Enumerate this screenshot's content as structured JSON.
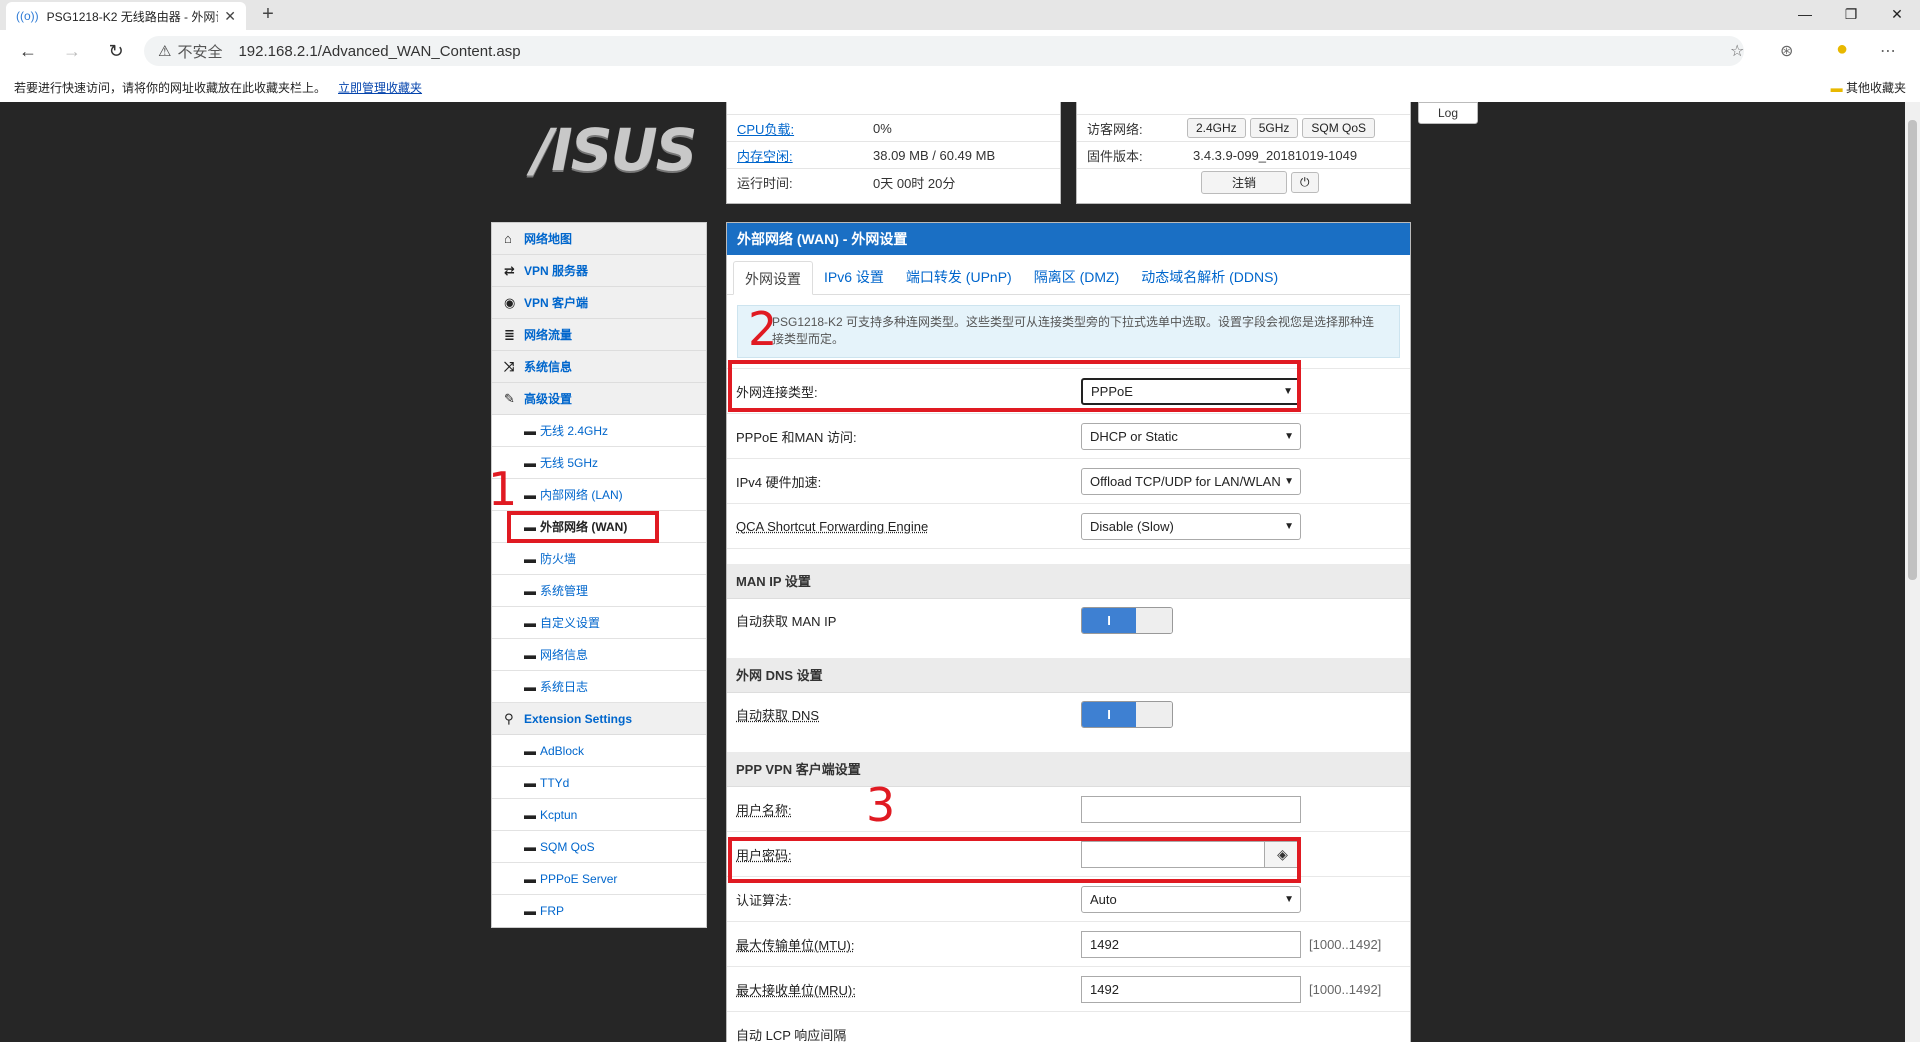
{
  "browser": {
    "tab_title": "PSG1218-K2 无线路由器 - 外网设",
    "tab_icon": "((o))",
    "new_tab": "+",
    "insecure_label": "不安全",
    "url": "192.168.2.1/Advanced_WAN_Content.asp",
    "bookmark_hint": "若要进行快速访问，请将你的网址收藏放在此收藏夹栏上。",
    "bookmark_link": "立即管理收藏夹",
    "other_bookmarks": "其他收藏夹"
  },
  "status": {
    "cpu_label": "CPU负载:",
    "cpu_value": "0%",
    "mem_label": "内存空闲:",
    "mem_value": "38.09 MB / 60.49 MB",
    "uptime_label": "运行时间:",
    "uptime_value": "0天 00时 20分",
    "guest_label": "访客网络:",
    "guest_buttons": [
      "2.4GHz",
      "5GHz",
      "SQM QoS"
    ],
    "fw_label": "固件版本:",
    "fw_value": "3.4.3.9-099_20181019-1049",
    "logout": "注销",
    "log": "Log"
  },
  "logo": "/ISUS",
  "sidebar": {
    "menus": [
      {
        "icon": "⌂",
        "label": "网络地图"
      },
      {
        "icon": "⇄",
        "label": "VPN 服务器"
      },
      {
        "icon": "◉",
        "label": "VPN 客户端"
      },
      {
        "icon": "≣",
        "label": "网络流量"
      },
      {
        "icon": "⤨",
        "label": "系统信息"
      },
      {
        "icon": "✎",
        "label": "高级设置"
      }
    ],
    "advanced": [
      "无线 2.4GHz",
      "无线 5GHz",
      "内部网络 (LAN)",
      "外部网络 (WAN)",
      "防火墙",
      "系统管理",
      "自定义设置",
      "网络信息",
      "系统日志"
    ],
    "ext_menu": {
      "icon": "⚲",
      "label": "Extension Settings"
    },
    "extensions": [
      "AdBlock",
      "TTYd",
      "Kcptun",
      "SQM QoS",
      "PPPoE Server",
      "FRP"
    ]
  },
  "annotations": [
    "1",
    "2",
    "3"
  ],
  "main": {
    "title": "外部网络 (WAN) - 外网设置",
    "tabs": [
      "外网设置",
      "IPv6 设置",
      "端口转发 (UPnP)",
      "隔离区 (DMZ)",
      "动态域名解析 (DDNS)"
    ],
    "info": "PSG1218-K2 可支持多种连网类型。这些类型可从连接类型旁的下拉式选单中选取。设置字段会视您是选择那种连接类型而定。",
    "wan_type_label": "外网连接类型:",
    "wan_type_value": "PPPoE",
    "pppoe_man_label": "PPPoE 和MAN 访问:",
    "pppoe_man_value": "DHCP or Static",
    "hw_label": "IPv4 硬件加速:",
    "hw_value": "Offload TCP/UDP for LAN/WLAN",
    "qca_label": "QCA Shortcut Forwarding Engine",
    "qca_value": "Disable (Slow)",
    "man_section": "MAN IP 设置",
    "auto_ip_label": "自动获取 MAN IP",
    "toggle_on": "I",
    "dns_section": "外网 DNS 设置",
    "auto_dns_label": "自动获取 DNS",
    "vpn_section": "PPP VPN 客户端设置",
    "user_label": "用户名称:",
    "user_value": "",
    "pass_label": "用户密码:",
    "pass_value": "",
    "auth_label": "认证算法:",
    "auth_value": "Auto",
    "mtu_label": "最大传输单位(MTU):",
    "mtu_value": "1492",
    "mtu_range": "[1000..1492]",
    "mru_label": "最大接收单位(MRU):",
    "mru_value": "1492",
    "mru_range": "[1000..1492]",
    "lcp_label": "自动 LCP 响应间隔"
  }
}
